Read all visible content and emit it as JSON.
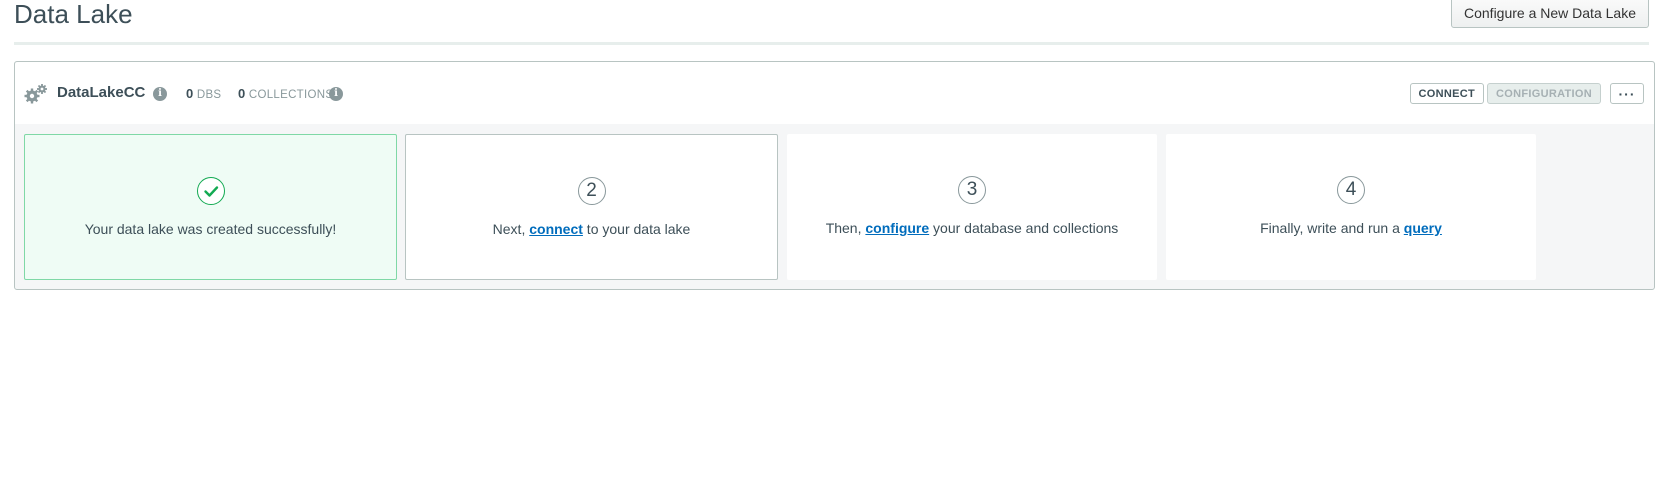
{
  "page": {
    "title": "Data Lake",
    "new_button_label": "Configure a New Data Lake"
  },
  "lake": {
    "name": "DataLakeCC",
    "dbs_count": "0",
    "dbs_label": "DBS",
    "collections_count": "0",
    "collections_label": "COLLECTIONS",
    "connect_label": "CONNECT",
    "configuration_label": "CONFIGURATION",
    "more_label": "···",
    "info_glyph": "i"
  },
  "steps": {
    "s1": {
      "text": "Your data lake was created successfully!"
    },
    "s2": {
      "number": "2",
      "before": "Next, ",
      "link": "connect",
      "after": " to your data lake"
    },
    "s3": {
      "number": "3",
      "before": "Then, ",
      "link": "configure",
      "after": " your database and collections"
    },
    "s4": {
      "number": "4",
      "before": "Finally, write and run a ",
      "link": "query",
      "after": ""
    }
  },
  "colors": {
    "success_bg": "#effcf5",
    "success_border": "#7fd8a6",
    "check_green": "#13aa52",
    "link_blue": "#006cbc"
  }
}
